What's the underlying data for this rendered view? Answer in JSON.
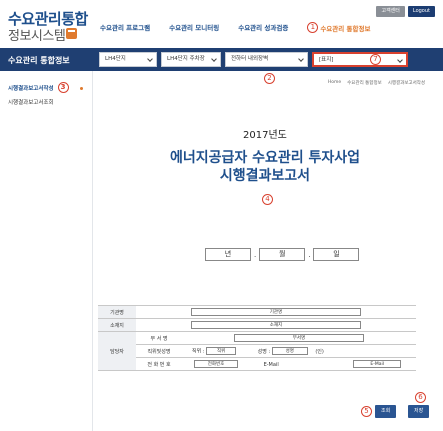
{
  "header": {
    "logo_line1": "수요관리통합",
    "logo_line2": "정보시스템",
    "top_buttons": [
      "고객센터",
      "Logout"
    ],
    "nav": [
      "수요관리 프로그램",
      "수요관리 모니터링",
      "수요관리 성과검증",
      "수요관리 통합정보"
    ],
    "active_nav_marker": "1"
  },
  "subbar": {
    "title": "수요관리 통합정보",
    "selects": [
      "LH4단지",
      "LH4단지 주차장",
      "전하터 내외장벽",
      "[표지]"
    ],
    "marker_select": "7",
    "marker_below": "2"
  },
  "sidebar": {
    "items": [
      "시행결과보고서작성",
      "시행결과보고서조회"
    ],
    "marker": "3"
  },
  "breadcrumb": [
    "Home",
    "수요관리 통합정보",
    "시행결과보고서작성"
  ],
  "document": {
    "year": "2017년도",
    "title_line1": "에너지공급자 수요관리 투자사업",
    "title_line2": "시행결과보고서",
    "marker": "4",
    "date": {
      "year": "년",
      "month": "월",
      "day": "일"
    }
  },
  "form": {
    "org_label": "기관명",
    "org_value": "기관명",
    "addr_label": "소재지",
    "addr_value": "소재지",
    "contact_label": "담당자",
    "dept_label": "부 서 명",
    "dept_value": "부서명",
    "position_label": "직위및성명",
    "position_prefix": "직위 :",
    "position_value": "직위",
    "name_prefix": "성명 :",
    "name_value": "성명",
    "seal": "(인)",
    "phone_label": "전 화 번 호",
    "phone_value": "전화번호",
    "email_label": "E-Mail",
    "email_value": "E-Mail"
  },
  "actions": {
    "marker_left": "5",
    "marker_right": "6",
    "query": "조회",
    "save": "저장"
  },
  "colors": {
    "navy": "#1f3f72",
    "accent": "#e07a2e",
    "marker": "#d8412f",
    "title": "#1e4f8c"
  }
}
